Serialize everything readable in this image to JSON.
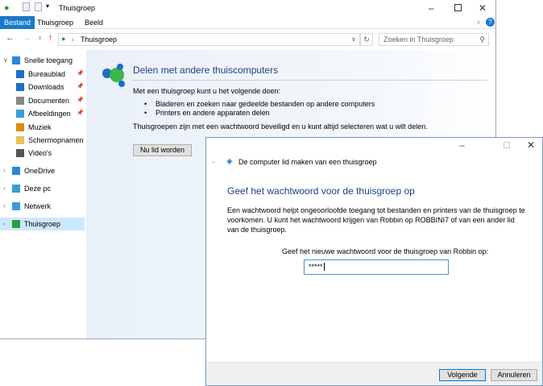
{
  "explorer": {
    "title": "Thuisgroep",
    "ribbon_tabs": [
      "Bestand",
      "Thuisgroep",
      "Beeld"
    ],
    "address": "Thuisgroep",
    "search_placeholder": "Zoeken in Thuisgroep",
    "sidebar": [
      {
        "label": "Snelle toegang",
        "top": true
      },
      {
        "label": "Bureaublad",
        "pinned": true
      },
      {
        "label": "Downloads",
        "pinned": true
      },
      {
        "label": "Documenten",
        "pinned": true
      },
      {
        "label": "Afbeeldingen",
        "pinned": true
      },
      {
        "label": "Muziek"
      },
      {
        "label": "Schermopnamen"
      },
      {
        "label": "Video's"
      },
      {
        "label": "OneDrive",
        "top": true
      },
      {
        "label": "Deze pc",
        "top": true
      },
      {
        "label": "Netwerk",
        "top": true
      },
      {
        "label": "Thuisgroep",
        "top": true,
        "selected": true
      }
    ],
    "content": {
      "title": "Delen met andere thuiscomputers",
      "intro": "Met een thuisgroep kunt u het volgende doen:",
      "bullets": [
        "Bladeren en zoeken naar gedeelde bestanden op andere computers",
        "Printers en andere apparaten delen"
      ],
      "note": "Thuisgroepen zijn met een wachtwoord beveiligd en u kunt altijd selecteren wat u wilt delen.",
      "join_button": "Nu lid worden"
    }
  },
  "dialog": {
    "header": "De computer lid maken van een thuisgroep",
    "heading": "Geef het wachtwoord voor de thuisgroep op",
    "description": "Een wachtwoord helpt ongeoorloofde toegang tot bestanden en printers van de thuisgroep te voorkomen. U kunt het wachtwoord krijgen van Robbin op ROBBINI7 of van een ander lid van de thuisgroep.",
    "prompt": "Geef het nieuwe wachtwoord voor de thuisgroep van Robbin op:",
    "password": "*****",
    "next_button": "Volgende",
    "cancel_button": "Annuleren"
  }
}
